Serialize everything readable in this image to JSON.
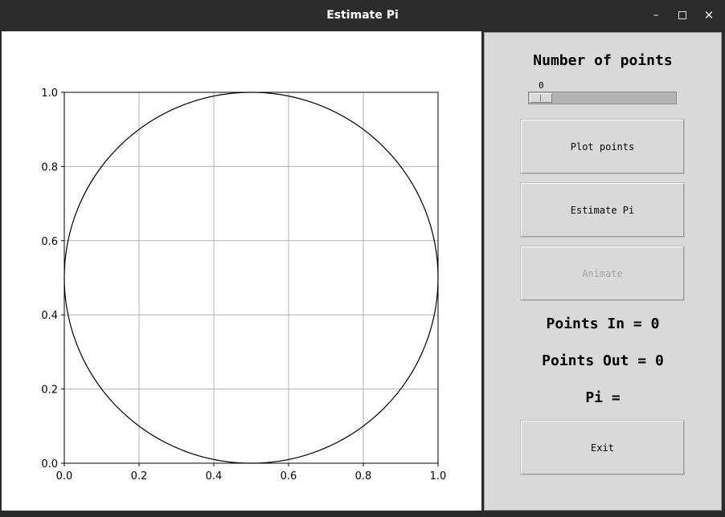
{
  "window": {
    "title": "Estimate Pi",
    "controls": {
      "minimize": "–",
      "close": "✕"
    }
  },
  "chart_data": {
    "type": "scatter",
    "x": [],
    "y": [],
    "xlim": [
      0.0,
      1.0
    ],
    "ylim": [
      0.0,
      1.0
    ],
    "xticks": [
      "0.0",
      "0.2",
      "0.4",
      "0.6",
      "0.8",
      "1.0"
    ],
    "yticks": [
      "0.0",
      "0.2",
      "0.4",
      "0.6",
      "0.8",
      "1.0"
    ],
    "grid": true,
    "circle": {
      "center": [
        0.5,
        0.5
      ],
      "radius": 0.5
    }
  },
  "panel": {
    "number_label": "Number of points",
    "slider": {
      "value": "0",
      "position": 0
    },
    "buttons": {
      "plot": "Plot points",
      "estimate": "Estimate Pi",
      "animate": "Animate",
      "exit": "Exit"
    },
    "points_in": "Points In = 0",
    "points_out": "Points Out = 0",
    "pi": "Pi ="
  },
  "colors": {
    "panel_bg": "#d9d9d9",
    "disabled_text": "#a3a3a3",
    "grid": "#b0b0b0"
  }
}
